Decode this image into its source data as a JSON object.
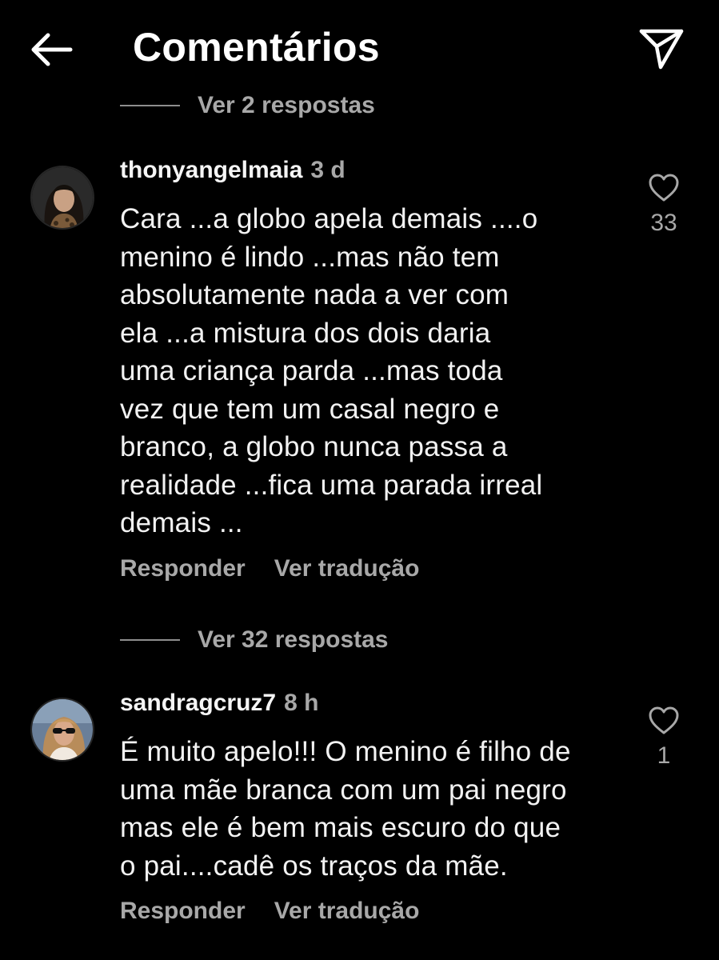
{
  "header": {
    "title": "Comentários",
    "back_icon": "arrow-left-icon",
    "send_icon": "paper-plane-icon"
  },
  "top_replies": {
    "label": "Ver 2 respostas"
  },
  "comments": [
    {
      "username": "thonyangelmaia",
      "time": "3 d",
      "lines": [
        "Cara ...a globo apela demais ....o",
        "menino é lindo ...mas não tem",
        "absolutamente nada a ver com",
        "ela ...a mistura dos dois daria",
        "uma criança parda ...mas toda",
        "vez que tem um casal negro e",
        "branco, a globo nunca passa a",
        "realidade ...fica uma parada irreal",
        "demais ..."
      ],
      "reply_label": "Responder",
      "translate_label": "Ver tradução",
      "likes": "33",
      "replies_label": "Ver 32 respostas"
    },
    {
      "username": "sandragcruz7",
      "time": "8 h",
      "lines": [
        "É muito apelo!!! O menino é filho de",
        "uma mãe branca com um pai negro",
        "mas ele é bem mais escuro do que",
        "o pai....cadê os traços da mãe."
      ],
      "reply_label": "Responder",
      "translate_label": "Ver tradução",
      "likes": "1"
    }
  ],
  "colors": {
    "background": "#000000",
    "text": "#f2f2f2",
    "secondary": "#a8a8a8"
  }
}
